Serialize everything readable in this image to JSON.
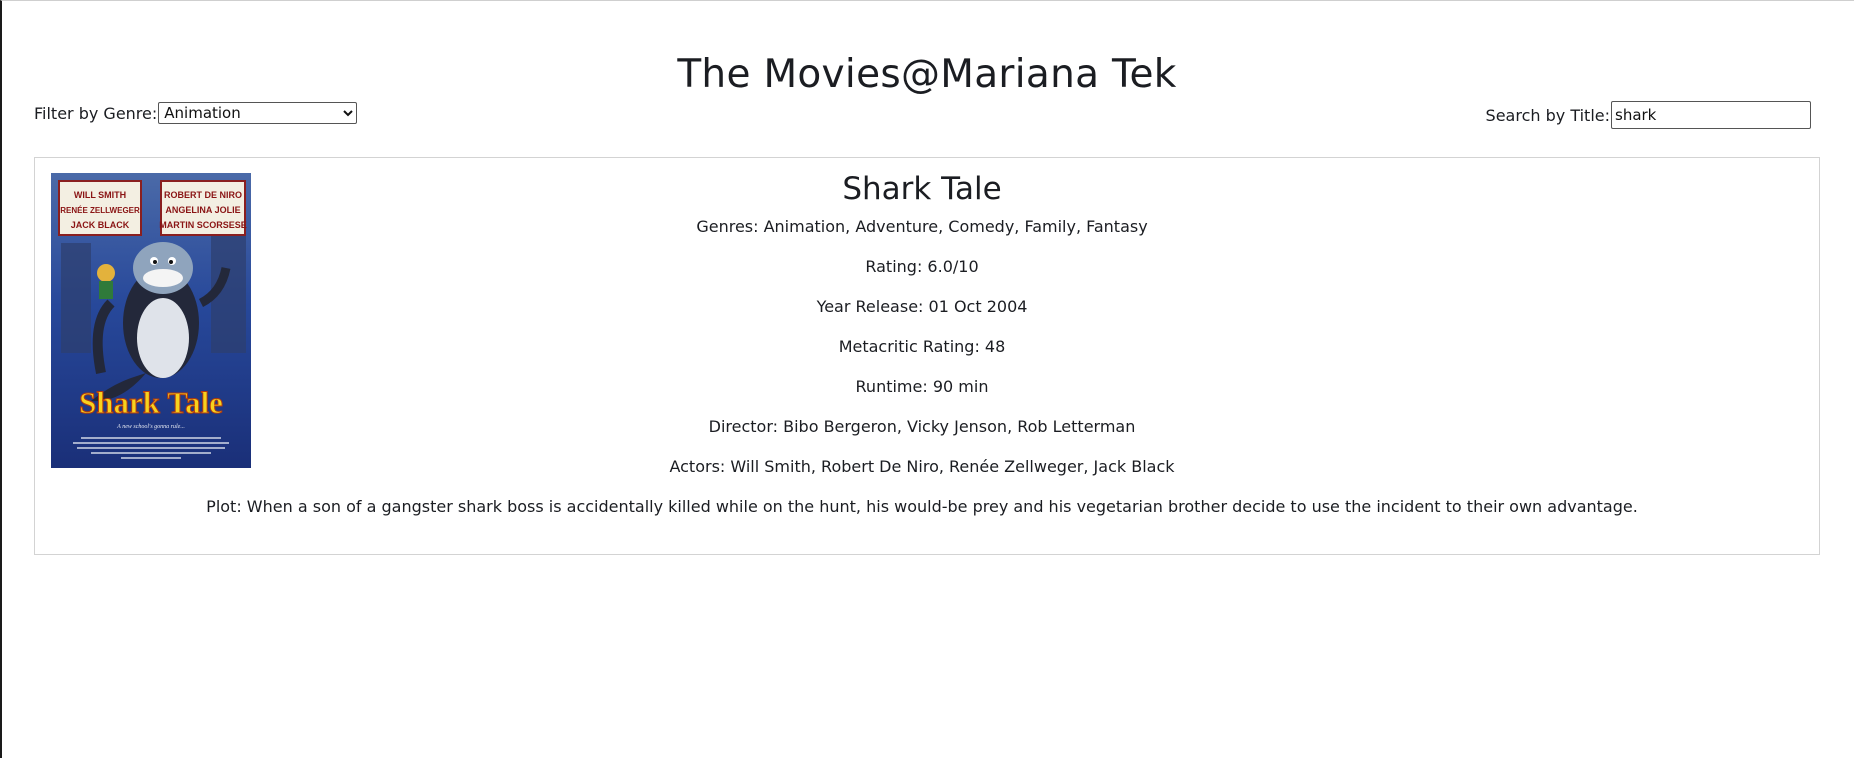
{
  "header": {
    "title": "The Movies@Mariana Tek"
  },
  "filter": {
    "label": "Filter by Genre:",
    "selected": "Animation"
  },
  "search": {
    "label": "Search by Title:",
    "value": "shark"
  },
  "movie": {
    "title": "Shark Tale",
    "genres": "Genres: Animation, Adventure, Comedy, Family, Fantasy",
    "rating": "Rating: 6.0/10",
    "release": "Year Release: 01 Oct 2004",
    "metacritic": "Metacritic Rating: 48",
    "runtime": "Runtime: 90 min",
    "director": "Director: Bibo Bergeron, Vicky Jenson, Rob Letterman",
    "actors": "Actors: Will Smith, Robert De Niro, Renée Zellweger, Jack Black",
    "plot": "Plot: When a son of a gangster shark boss is accidentally killed while on the hunt, his would-be prey and his vegetarian brother decide to use the incident to their own advantage.",
    "poster": {
      "marquee_left": [
        "WILL SMITH",
        "RENÉE ZELLWEGER",
        "JACK BLACK"
      ],
      "marquee_right": [
        "ROBERT DE NIRO",
        "ANGELINA JOLIE",
        "MARTIN SCORSESE"
      ],
      "logo": "Shark Tale",
      "tagline": "A new school's gonna rule..."
    }
  },
  "colors": {
    "text": "#1b1d22",
    "poster_bg": "#1f3f8f",
    "logo_yellow": "#f7d21e"
  }
}
